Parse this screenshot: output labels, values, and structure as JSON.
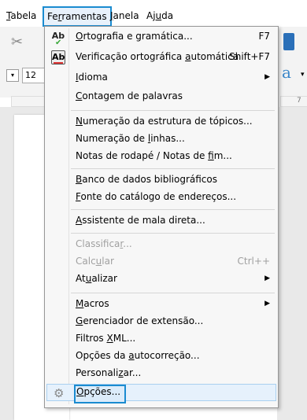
{
  "menubar": {
    "tabela": {
      "u": "T",
      "rest": "abela"
    },
    "ferramentas": {
      "pre": "Fe",
      "u": "r",
      "rest": "ramentas"
    },
    "janela": {
      "u": "J",
      "rest": "anela"
    },
    "ajuda": {
      "pre": "Aj",
      "u": "u",
      "rest": "da"
    }
  },
  "background": {
    "font_size_value": "12",
    "ruler_mark": "7"
  },
  "menu": {
    "items": [
      {
        "pre": "",
        "u": "O",
        "rest": "rtografia e gramática...",
        "shortcut": "F7",
        "icon": "spellcheck-icon"
      },
      {
        "pre": "Verificação ortográfica ",
        "u": "a",
        "rest": "utomática",
        "shortcut": "Shift+F7",
        "icon": "autospell-icon"
      },
      {
        "pre": "",
        "u": "I",
        "rest": "dioma",
        "submenu": true
      },
      {
        "pre": "",
        "u": "C",
        "rest": "ontagem de palavras"
      },
      {
        "pre": "",
        "u": "N",
        "rest": "umeração da estrutura de tópicos..."
      },
      {
        "pre": "Numeração de ",
        "u": "l",
        "rest": "inhas..."
      },
      {
        "pre": "Notas de rodapé / Notas de ",
        "u": "f",
        "rest": "im..."
      },
      {
        "pre": "",
        "u": "B",
        "rest": "anco de dados bibliográficos"
      },
      {
        "pre": "",
        "u": "F",
        "rest": "onte do catálogo de endereços..."
      },
      {
        "pre": "",
        "u": "A",
        "rest": "ssistente de mala direta..."
      },
      {
        "pre": "Classifica",
        "u": "r",
        "rest": "...",
        "disabled": true
      },
      {
        "pre": "Calc",
        "u": "u",
        "rest": "lar",
        "shortcut": "Ctrl++",
        "disabled": true
      },
      {
        "pre": "At",
        "u": "u",
        "rest": "alizar",
        "submenu": true
      },
      {
        "pre": "",
        "u": "M",
        "rest": "acros",
        "submenu": true
      },
      {
        "pre": "",
        "u": "G",
        "rest": "erenciador de extensão..."
      },
      {
        "pre": "Filtros ",
        "u": "X",
        "rest": "ML..."
      },
      {
        "pre": "Opções da ",
        "u": "a",
        "rest": "utocorreção..."
      },
      {
        "pre": "Personali",
        "u": "z",
        "rest": "ar..."
      },
      {
        "pre": "",
        "u": "O",
        "rest": "pções...",
        "icon": "gear-icon"
      }
    ]
  },
  "colors": {
    "highlight_border": "#1a8bd0",
    "disabled_text": "#a0a0a0"
  }
}
